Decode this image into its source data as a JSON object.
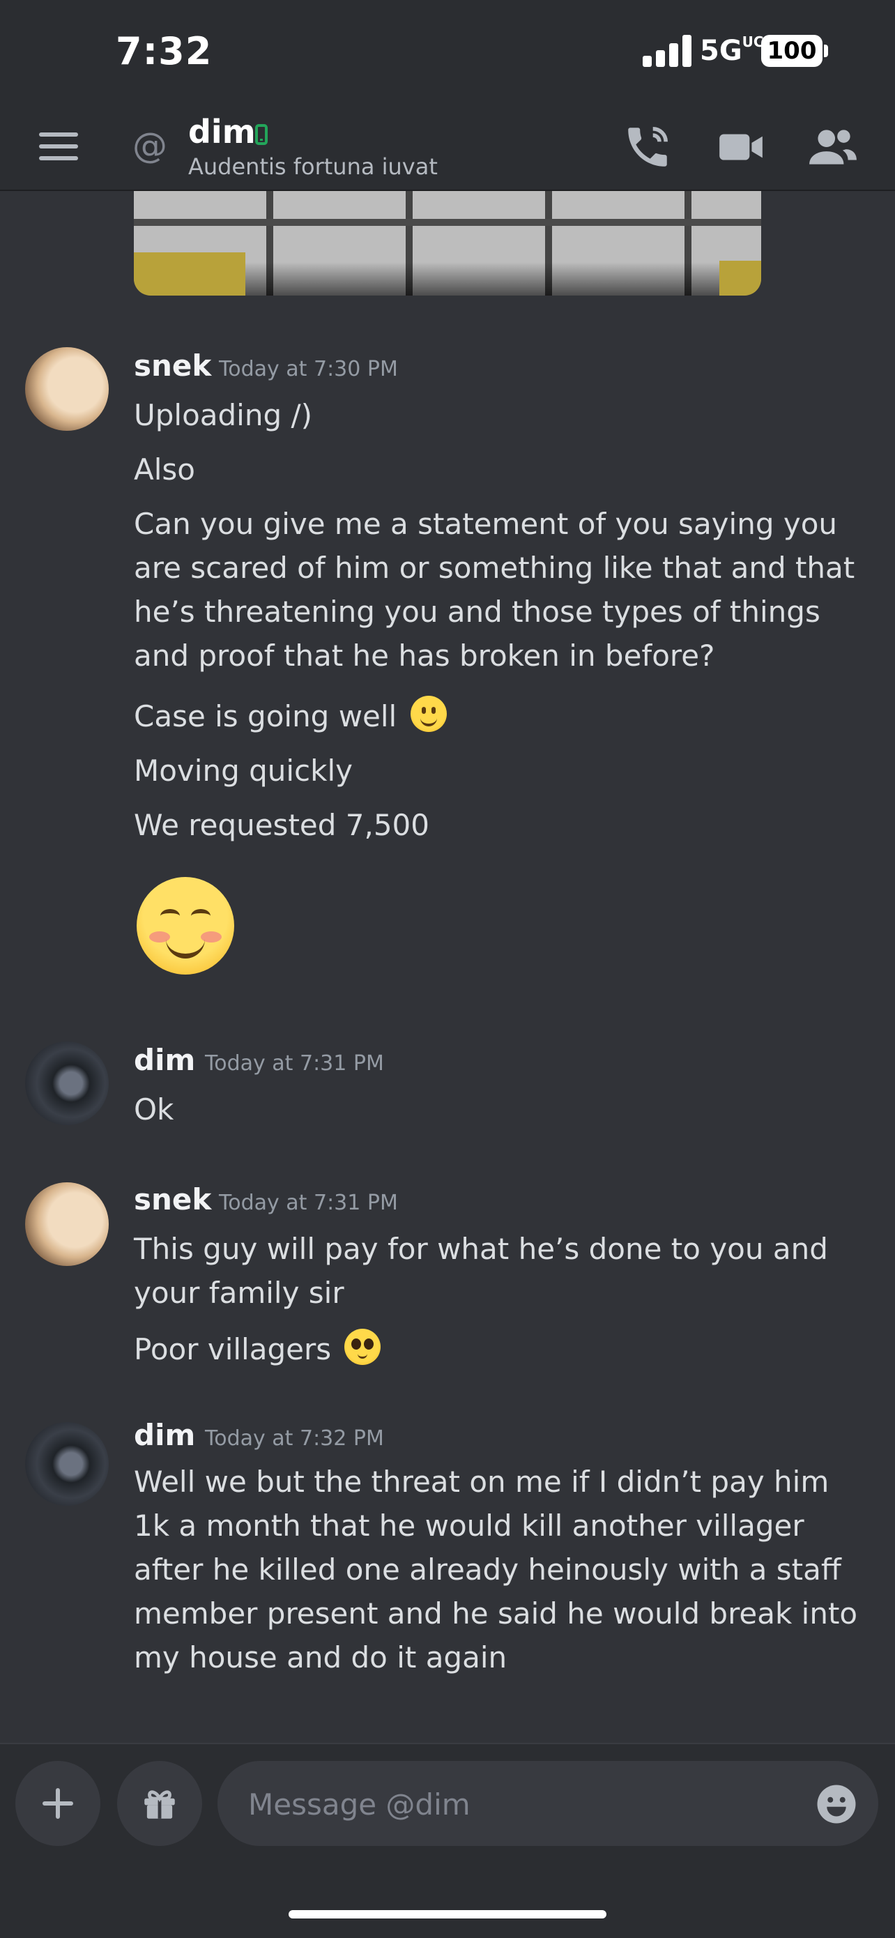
{
  "status_bar": {
    "time": "7:32",
    "network": "5G",
    "network_suffix": "UC",
    "battery": "100"
  },
  "header": {
    "dm_name": "dim",
    "status_text": "Audentis fortuna iuvat"
  },
  "messages": [
    {
      "author": "snek",
      "timestamp": "Today at 7:30 PM",
      "lines": [
        "Uploading /)",
        "Also",
        "Can you give me a statement of you saying you are scared of him or something like that and that he’s threatening you and those types of things and proof that he has broken in before?",
        "Case is going well",
        "Moving quickly",
        "We requested 7,500"
      ]
    },
    {
      "author": "dim",
      "timestamp": "Today at 7:31 PM",
      "lines": [
        "Ok"
      ]
    },
    {
      "author": "snek",
      "timestamp": "Today at 7:31 PM",
      "lines": [
        "This guy will pay for what he’s done to you and your family sir",
        "Poor villagers"
      ]
    },
    {
      "author": "dim",
      "timestamp": "Today at 7:32 PM",
      "lines": [
        "Well we but the threat on me if I didn’t pay him 1k a month that he would kill another villager after he killed one already heinously with a staff member present and he said he would break into my house and do it again"
      ]
    }
  ],
  "composer": {
    "placeholder": "Message @dim"
  },
  "colors": {
    "background": "#313338",
    "header": "#2b2d31",
    "online": "#23a55a"
  }
}
